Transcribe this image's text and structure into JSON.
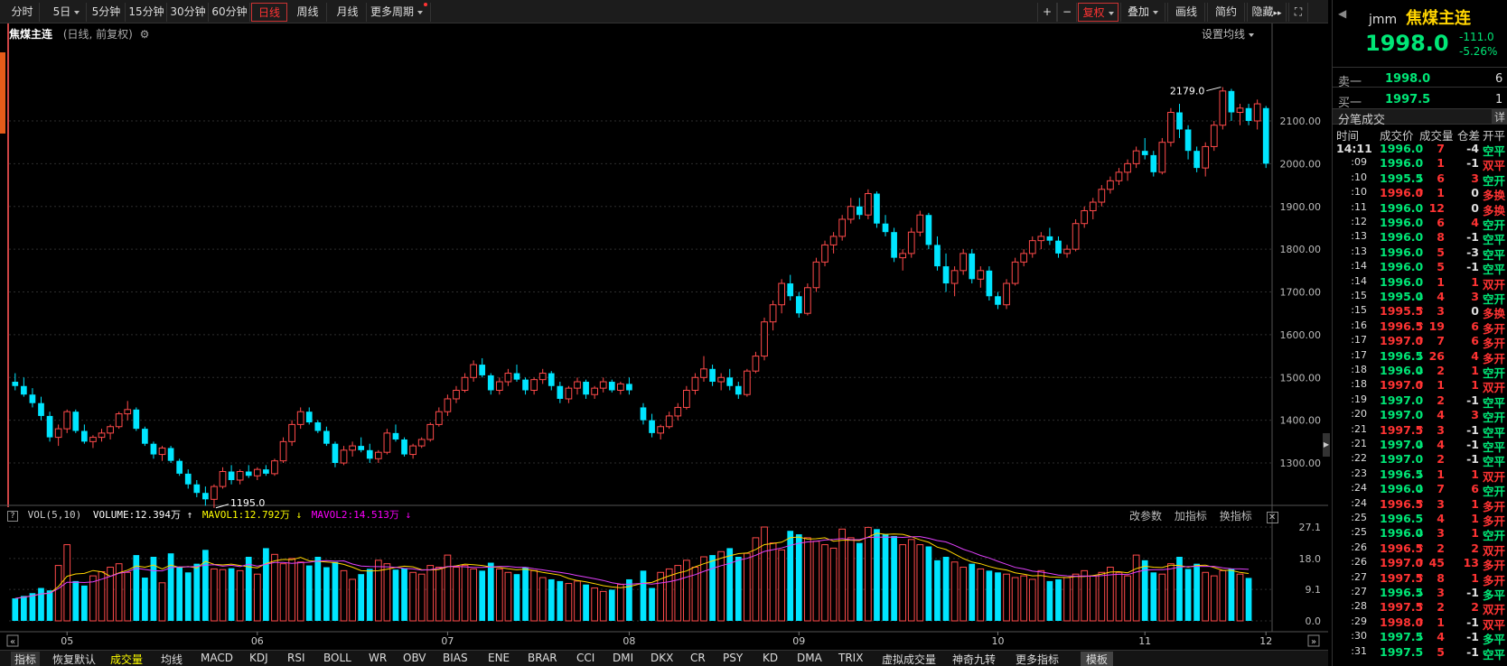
{
  "toolbar": {
    "periods": [
      "分时",
      "5日",
      "5分钟",
      "15分钟",
      "30分钟",
      "60分钟",
      "日线",
      "周线",
      "月线",
      "更多周期"
    ],
    "active_period": "日线",
    "right_buttons": [
      "+",
      "−",
      "复权",
      "叠加",
      "画线",
      "简约",
      "隐藏"
    ]
  },
  "chart_info": {
    "name": "焦煤主连",
    "mode": "(日线, 前复权)",
    "ma_setting": "设置均线"
  },
  "vol_info": {
    "label": "VOL(5,10)",
    "volume": "VOLUME:12.394万",
    "mavol1": "MAVOL1:12.792万",
    "mavol2": "MAVOL2:14.513万",
    "actions": [
      "改参数",
      "加指标",
      "换指标"
    ]
  },
  "bottom_tabs": [
    "指标",
    "恢复默认",
    "成交量",
    "均线",
    "MACD",
    "KDJ",
    "RSI",
    "BOLL",
    "WR",
    "OBV",
    "BIAS",
    "ENE",
    "BRAR",
    "CCI",
    "DMI",
    "DKX",
    "CR",
    "PSY",
    "KD",
    "DMA",
    "TRIX",
    "虚拟成交量",
    "神奇九转",
    "更多指标",
    "模板"
  ],
  "quote": {
    "code": "jmm",
    "name": "焦煤主连",
    "price": "1998.0",
    "change": "-111.0",
    "change_pct": "-5.26%",
    "ask_label": "卖一",
    "ask_price": "1998.0",
    "ask_vol": "6",
    "bid_label": "买一",
    "bid_price": "1997.5",
    "bid_vol": "1"
  },
  "trades_panel": {
    "title": "分笔成交",
    "detail": "详",
    "headers": [
      "时间",
      "成交价",
      "成交量",
      "仓差",
      "开平"
    ],
    "rows": [
      {
        "t": "14:11",
        "p": "1996.0",
        "a": "",
        "v": "7",
        "d": "-4",
        "k": "空平"
      },
      {
        "t": ":09",
        "p": "1996.0",
        "a": "",
        "v": "1",
        "d": "-1",
        "k": "双平"
      },
      {
        "t": ":10",
        "p": "1995.5",
        "a": "↓",
        "v": "6",
        "d": "3",
        "k": "空开"
      },
      {
        "t": ":10",
        "p": "1996.0",
        "a": "↑",
        "v": "1",
        "d": "0",
        "k": "多换"
      },
      {
        "t": ":11",
        "p": "1996.0",
        "a": "",
        "v": "12",
        "d": "0",
        "k": "多换"
      },
      {
        "t": ":12",
        "p": "1996.0",
        "a": "",
        "v": "6",
        "d": "4",
        "k": "空开"
      },
      {
        "t": ":13",
        "p": "1996.0",
        "a": "",
        "v": "8",
        "d": "-1",
        "k": "空平"
      },
      {
        "t": ":13",
        "p": "1996.0",
        "a": "",
        "v": "5",
        "d": "-3",
        "k": "空平"
      },
      {
        "t": ":14",
        "p": "1996.0",
        "a": "",
        "v": "5",
        "d": "-1",
        "k": "空平"
      },
      {
        "t": ":14",
        "p": "1996.0",
        "a": "",
        "v": "1",
        "d": "1",
        "k": "双开"
      },
      {
        "t": ":15",
        "p": "1995.0",
        "a": "↓",
        "v": "4",
        "d": "3",
        "k": "空开"
      },
      {
        "t": ":15",
        "p": "1995.5",
        "a": "↑",
        "v": "3",
        "d": "0",
        "k": "多换"
      },
      {
        "t": ":16",
        "p": "1996.5",
        "a": "↑",
        "v": "19",
        "d": "6",
        "k": "多开"
      },
      {
        "t": ":17",
        "p": "1997.0",
        "a": "↑",
        "v": "7",
        "d": "6",
        "k": "多开"
      },
      {
        "t": ":17",
        "p": "1996.5",
        "a": "↓",
        "v": "26",
        "d": "4",
        "k": "多开"
      },
      {
        "t": ":18",
        "p": "1996.0",
        "a": "↓",
        "v": "2",
        "d": "1",
        "k": "空开"
      },
      {
        "t": ":18",
        "p": "1997.0",
        "a": "↑",
        "v": "1",
        "d": "1",
        "k": "双开"
      },
      {
        "t": ":19",
        "p": "1997.0",
        "a": "",
        "v": "2",
        "d": "-1",
        "k": "空平"
      },
      {
        "t": ":20",
        "p": "1997.0",
        "a": "",
        "v": "4",
        "d": "3",
        "k": "空开"
      },
      {
        "t": ":21",
        "p": "1997.5",
        "a": "↑",
        "v": "3",
        "d": "-1",
        "k": "空平"
      },
      {
        "t": ":21",
        "p": "1997.0",
        "a": "↓",
        "v": "4",
        "d": "-1",
        "k": "空平"
      },
      {
        "t": ":22",
        "p": "1997.0",
        "a": "",
        "v": "2",
        "d": "-1",
        "k": "空平"
      },
      {
        "t": ":23",
        "p": "1996.5",
        "a": "↓",
        "v": "1",
        "d": "1",
        "k": "双开"
      },
      {
        "t": ":24",
        "p": "1996.0",
        "a": "↓",
        "v": "7",
        "d": "6",
        "k": "空开"
      },
      {
        "t": ":24",
        "p": "1996.5",
        "a": "↑",
        "v": "3",
        "d": "1",
        "k": "多开"
      },
      {
        "t": ":25",
        "p": "1996.5",
        "a": "",
        "v": "4",
        "d": "1",
        "k": "多开"
      },
      {
        "t": ":25",
        "p": "1996.0",
        "a": "↓",
        "v": "3",
        "d": "1",
        "k": "空开"
      },
      {
        "t": ":26",
        "p": "1996.5",
        "a": "↑",
        "v": "2",
        "d": "2",
        "k": "双开"
      },
      {
        "t": ":26",
        "p": "1997.0",
        "a": "↑",
        "v": "45",
        "d": "13",
        "k": "多开"
      },
      {
        "t": ":27",
        "p": "1997.5",
        "a": "↑",
        "v": "8",
        "d": "1",
        "k": "多开"
      },
      {
        "t": ":27",
        "p": "1996.5",
        "a": "↓",
        "v": "3",
        "d": "-1",
        "k": "多平"
      },
      {
        "t": ":28",
        "p": "1997.5",
        "a": "↑",
        "v": "2",
        "d": "2",
        "k": "双开"
      },
      {
        "t": ":29",
        "p": "1998.0",
        "a": "↑",
        "v": "1",
        "d": "-1",
        "k": "双平"
      },
      {
        "t": ":30",
        "p": "1997.5",
        "a": "↓",
        "v": "4",
        "d": "-1",
        "k": "多平"
      },
      {
        "t": ":31",
        "p": "1997.5",
        "a": "",
        "v": "5",
        "d": "-1",
        "k": "空平"
      }
    ]
  },
  "chart_data": {
    "type": "candlestick",
    "months": [
      "05",
      "06",
      "07",
      "08",
      "09",
      "10",
      "11",
      "12"
    ],
    "y_ticks": [
      1300,
      1400,
      1500,
      1600,
      1700,
      1800,
      1900,
      2000,
      2100
    ],
    "vol_ticks": [
      "27.1",
      "18.0",
      "9.1",
      "0.0"
    ],
    "ylim": [
      1195,
      2179
    ],
    "vol_max": 27.1,
    "max_label": "2179.0",
    "min_label": "1195.0",
    "ohlc": [
      [
        1490,
        1510,
        1470,
        1480
      ],
      [
        1480,
        1500,
        1455,
        1460
      ],
      [
        1460,
        1475,
        1430,
        1440
      ],
      [
        1440,
        1455,
        1400,
        1410
      ],
      [
        1410,
        1420,
        1350,
        1360
      ],
      [
        1360,
        1390,
        1340,
        1380
      ],
      [
        1380,
        1425,
        1370,
        1420
      ],
      [
        1420,
        1425,
        1370,
        1375
      ],
      [
        1375,
        1390,
        1345,
        1350
      ],
      [
        1350,
        1365,
        1335,
        1360
      ],
      [
        1360,
        1380,
        1350,
        1370
      ],
      [
        1370,
        1390,
        1355,
        1385
      ],
      [
        1385,
        1420,
        1380,
        1415
      ],
      [
        1415,
        1445,
        1400,
        1425
      ],
      [
        1425,
        1430,
        1375,
        1380
      ],
      [
        1380,
        1385,
        1340,
        1345
      ],
      [
        1345,
        1350,
        1310,
        1320
      ],
      [
        1320,
        1340,
        1305,
        1335
      ],
      [
        1335,
        1340,
        1300,
        1305
      ],
      [
        1305,
        1310,
        1270,
        1275
      ],
      [
        1275,
        1285,
        1240,
        1250
      ],
      [
        1250,
        1260,
        1220,
        1230
      ],
      [
        1230,
        1245,
        1200,
        1215
      ],
      [
        1215,
        1250,
        1195,
        1245
      ],
      [
        1245,
        1290,
        1240,
        1280
      ],
      [
        1280,
        1295,
        1250,
        1260
      ],
      [
        1260,
        1285,
        1250,
        1280
      ],
      [
        1280,
        1295,
        1265,
        1270
      ],
      [
        1270,
        1290,
        1260,
        1285
      ],
      [
        1285,
        1295,
        1270,
        1275
      ],
      [
        1275,
        1310,
        1270,
        1305
      ],
      [
        1305,
        1360,
        1300,
        1350
      ],
      [
        1350,
        1400,
        1340,
        1390
      ],
      [
        1390,
        1430,
        1380,
        1420
      ],
      [
        1420,
        1430,
        1390,
        1395
      ],
      [
        1395,
        1400,
        1370,
        1375
      ],
      [
        1375,
        1385,
        1340,
        1345
      ],
      [
        1345,
        1350,
        1290,
        1300
      ],
      [
        1300,
        1340,
        1295,
        1330
      ],
      [
        1330,
        1350,
        1315,
        1340
      ],
      [
        1340,
        1360,
        1325,
        1330
      ],
      [
        1330,
        1345,
        1300,
        1310
      ],
      [
        1310,
        1330,
        1300,
        1325
      ],
      [
        1325,
        1380,
        1320,
        1370
      ],
      [
        1370,
        1390,
        1350,
        1355
      ],
      [
        1355,
        1360,
        1315,
        1320
      ],
      [
        1320,
        1345,
        1310,
        1340
      ],
      [
        1340,
        1360,
        1335,
        1355
      ],
      [
        1355,
        1395,
        1350,
        1390
      ],
      [
        1390,
        1430,
        1385,
        1420
      ],
      [
        1420,
        1460,
        1410,
        1450
      ],
      [
        1450,
        1480,
        1440,
        1470
      ],
      [
        1470,
        1510,
        1465,
        1500
      ],
      [
        1500,
        1540,
        1490,
        1530
      ],
      [
        1530,
        1545,
        1500,
        1505
      ],
      [
        1505,
        1510,
        1460,
        1470
      ],
      [
        1470,
        1500,
        1460,
        1490
      ],
      [
        1490,
        1520,
        1480,
        1510
      ],
      [
        1510,
        1530,
        1490,
        1495
      ],
      [
        1495,
        1500,
        1460,
        1470
      ],
      [
        1470,
        1500,
        1460,
        1495
      ],
      [
        1495,
        1520,
        1485,
        1510
      ],
      [
        1510,
        1515,
        1470,
        1480
      ],
      [
        1480,
        1490,
        1440,
        1450
      ],
      [
        1450,
        1480,
        1440,
        1475
      ],
      [
        1475,
        1500,
        1460,
        1490
      ],
      [
        1490,
        1495,
        1450,
        1460
      ],
      [
        1460,
        1480,
        1450,
        1475
      ],
      [
        1475,
        1500,
        1465,
        1490
      ],
      [
        1490,
        1495,
        1465,
        1470
      ],
      [
        1470,
        1490,
        1460,
        1485
      ],
      [
        1485,
        1500,
        1460,
        1470
      ],
      [
        1430,
        1440,
        1390,
        1400
      ],
      [
        1400,
        1415,
        1360,
        1370
      ],
      [
        1370,
        1390,
        1355,
        1385
      ],
      [
        1385,
        1420,
        1380,
        1410
      ],
      [
        1410,
        1440,
        1400,
        1430
      ],
      [
        1430,
        1480,
        1425,
        1470
      ],
      [
        1470,
        1510,
        1460,
        1500
      ],
      [
        1500,
        1550,
        1490,
        1520
      ],
      [
        1520,
        1530,
        1480,
        1490
      ],
      [
        1490,
        1510,
        1470,
        1500
      ],
      [
        1500,
        1520,
        1470,
        1480
      ],
      [
        1480,
        1490,
        1450,
        1460
      ],
      [
        1460,
        1520,
        1455,
        1515
      ],
      [
        1515,
        1560,
        1510,
        1550
      ],
      [
        1550,
        1640,
        1540,
        1630
      ],
      [
        1630,
        1680,
        1610,
        1670
      ],
      [
        1670,
        1730,
        1650,
        1720
      ],
      [
        1720,
        1740,
        1680,
        1690
      ],
      [
        1690,
        1700,
        1640,
        1650
      ],
      [
        1650,
        1720,
        1645,
        1710
      ],
      [
        1710,
        1780,
        1700,
        1770
      ],
      [
        1770,
        1820,
        1760,
        1810
      ],
      [
        1810,
        1840,
        1790,
        1830
      ],
      [
        1830,
        1880,
        1820,
        1870
      ],
      [
        1870,
        1920,
        1860,
        1900
      ],
      [
        1900,
        1920,
        1870,
        1880
      ],
      [
        1880,
        1940,
        1870,
        1930
      ],
      [
        1930,
        1935,
        1850,
        1860
      ],
      [
        1860,
        1880,
        1830,
        1840
      ],
      [
        1840,
        1850,
        1770,
        1780
      ],
      [
        1780,
        1800,
        1750,
        1790
      ],
      [
        1790,
        1850,
        1780,
        1840
      ],
      [
        1840,
        1890,
        1830,
        1880
      ],
      [
        1880,
        1885,
        1800,
        1810
      ],
      [
        1810,
        1830,
        1750,
        1760
      ],
      [
        1760,
        1790,
        1700,
        1720
      ],
      [
        1720,
        1760,
        1690,
        1750
      ],
      [
        1750,
        1800,
        1740,
        1790
      ],
      [
        1790,
        1800,
        1720,
        1730
      ],
      [
        1730,
        1760,
        1710,
        1750
      ],
      [
        1750,
        1760,
        1680,
        1690
      ],
      [
        1690,
        1700,
        1660,
        1670
      ],
      [
        1670,
        1730,
        1660,
        1720
      ],
      [
        1720,
        1780,
        1715,
        1770
      ],
      [
        1770,
        1800,
        1760,
        1790
      ],
      [
        1790,
        1830,
        1780,
        1820
      ],
      [
        1820,
        1840,
        1800,
        1830
      ],
      [
        1830,
        1850,
        1810,
        1820
      ],
      [
        1820,
        1830,
        1780,
        1790
      ],
      [
        1790,
        1810,
        1780,
        1800
      ],
      [
        1800,
        1870,
        1795,
        1860
      ],
      [
        1860,
        1900,
        1850,
        1890
      ],
      [
        1890,
        1920,
        1870,
        1910
      ],
      [
        1910,
        1950,
        1900,
        1940
      ],
      [
        1940,
        1970,
        1930,
        1960
      ],
      [
        1960,
        1990,
        1950,
        1980
      ],
      [
        1980,
        2010,
        1960,
        2000
      ],
      [
        2000,
        2040,
        1990,
        2030
      ],
      [
        2030,
        2060,
        2010,
        2020
      ],
      [
        2020,
        2030,
        1970,
        1980
      ],
      [
        1980,
        2060,
        1975,
        2050
      ],
      [
        2050,
        2130,
        2040,
        2120
      ],
      [
        2120,
        2140,
        2060,
        2080
      ],
      [
        2080,
        2090,
        2010,
        2030
      ],
      [
        2030,
        2040,
        1980,
        1990
      ],
      [
        1990,
        2050,
        1970,
        2040
      ],
      [
        2040,
        2100,
        2030,
        2090
      ],
      [
        2090,
        2179,
        2080,
        2170
      ],
      [
        2170,
        2175,
        2100,
        2120
      ],
      [
        2120,
        2140,
        2090,
        2130
      ],
      [
        2130,
        2140,
        2090,
        2100
      ],
      [
        2100,
        2150,
        2080,
        2140
      ],
      [
        2130,
        2135,
        1990,
        2000
      ]
    ],
    "volume": [
      6.5,
      7.2,
      8.0,
      9.5,
      8.8,
      16.0,
      22.0,
      11.5,
      10.2,
      13.0,
      14.2,
      15.5,
      16.5,
      14.0,
      19.0,
      12.5,
      18.5,
      11.0,
      19.5,
      15.5,
      14.0,
      16.5,
      20.5,
      15.0,
      14.8,
      15.2,
      14.5,
      18.5,
      13.5,
      21.0,
      19.2,
      16.5,
      18.0,
      17.0,
      16.0,
      18.5,
      15.5,
      17.0,
      14.5,
      12.0,
      13.5,
      15.0,
      17.5,
      16.5,
      14.8,
      15.2,
      14.0,
      13.5,
      16.0,
      15.5,
      19.0,
      15.5,
      16.0,
      15.0,
      14.5,
      16.8,
      15.0,
      14.0,
      13.5,
      15.5,
      14.5,
      12.5,
      12.0,
      11.5,
      10.8,
      11.5,
      10.5,
      9.5,
      8.5,
      9.0,
      10.5,
      12.0,
      14.5,
      9.5,
      14.0,
      15.0,
      16.0,
      17.5,
      15.5,
      18.5,
      19.0,
      20.0,
      21.0,
      18.5,
      19.5,
      24.0,
      27.1,
      22.5,
      20.5,
      26.0,
      25.0,
      24.0,
      23.0,
      22.0,
      21.0,
      26.5,
      24.0,
      22.5,
      27.0,
      26.5,
      25.0,
      24.5,
      22.0,
      23.5,
      22.0,
      21.5,
      17.5,
      18.5,
      17.0,
      15.5,
      16.5,
      15.0,
      14.5,
      14.0,
      13.5,
      12.5,
      13.0,
      12.0,
      14.5,
      11.5,
      12.0,
      12.5,
      13.5,
      14.5,
      13.0,
      14.0,
      15.5,
      14.0,
      13.0,
      19.0,
      17.5,
      14.0,
      13.5,
      16.5,
      18.5,
      15.0,
      16.5,
      14.0,
      13.0,
      14.5,
      15.0,
      13.5,
      12.394
    ]
  }
}
